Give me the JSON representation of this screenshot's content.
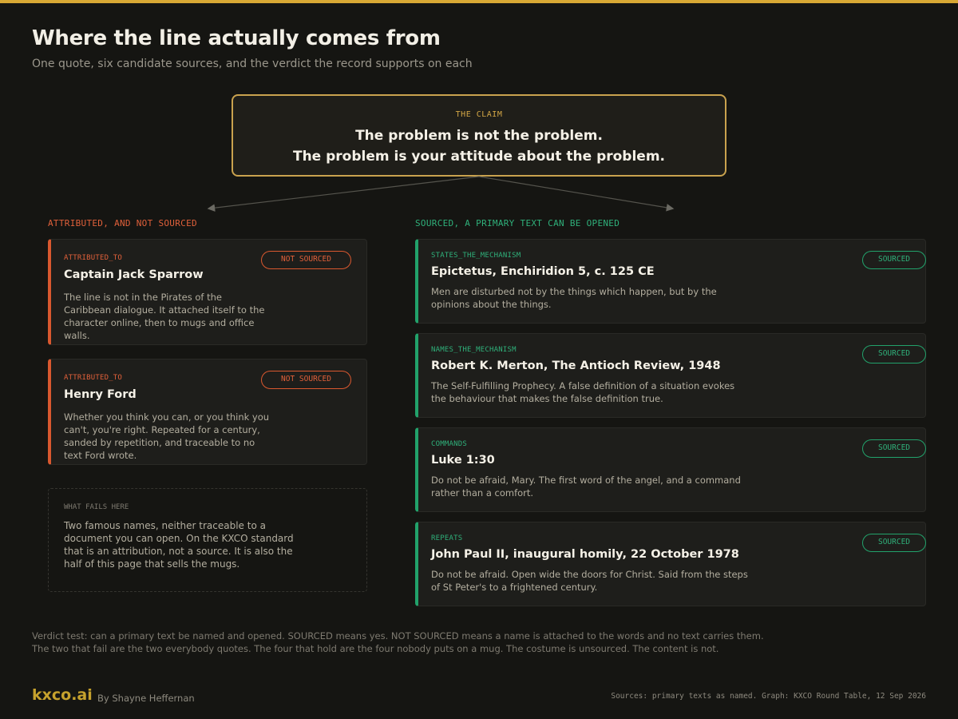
{
  "header": {
    "title": "Where the line actually comes from",
    "subtitle": "One quote, six candidate sources, and the verdict the record supports on each"
  },
  "claim": {
    "label": "THE CLAIM",
    "line1": "The problem is not the problem.",
    "line2": "The problem is your attitude about the problem."
  },
  "sections": {
    "left": "ATTRIBUTED, AND NOT SOURCED",
    "right": "SOURCED, A PRIMARY TEXT CAN BE OPENED"
  },
  "left_cards": [
    {
      "tag": "ATTRIBUTED_TO",
      "name": "Captain Jack Sparrow",
      "badge": "NOT SOURCED",
      "body": "The line is not in the Pirates of the Caribbean dialogue. It attached itself to the character online, then to mugs and office walls."
    },
    {
      "tag": "ATTRIBUTED_TO",
      "name": "Henry Ford",
      "badge": "NOT SOURCED",
      "body": "Whether you think you can, or you think you can't, you're right. Repeated for a century, sanded by repetition, and traceable to no text Ford wrote."
    }
  ],
  "fails": {
    "label": "WHAT FAILS HERE",
    "body": "Two famous names, neither traceable to a document you can open. On the KXCO standard that is an attribution, not a source. It is also the half of this page that sells the mugs."
  },
  "right_cards": [
    {
      "tag": "STATES_THE_MECHANISM",
      "name": "Epictetus, Enchiridion 5, c. 125 CE",
      "badge": "SOURCED",
      "body": "Men are disturbed not by the things which happen, but by the opinions about the things."
    },
    {
      "tag": "NAMES_THE_MECHANISM",
      "name": "Robert K. Merton, The Antioch Review, 1948",
      "badge": "SOURCED",
      "body": "The Self-Fulfilling Prophecy. A false definition of a situation evokes the behaviour that makes the false definition true."
    },
    {
      "tag": "COMMANDS",
      "name": "Luke 1:30",
      "badge": "SOURCED",
      "body": "Do not be afraid, Mary. The first word of the angel, and a command rather than a comfort."
    },
    {
      "tag": "REPEATS",
      "name": "John Paul II, inaugural homily, 22 October 1978",
      "badge": "SOURCED",
      "body": "Do not be afraid. Open wide the doors for Christ. Said from the steps of St Peter's to a frightened century."
    }
  ],
  "verdict": {
    "line1": "Verdict test: can a primary text be named and opened. SOURCED means yes. NOT SOURCED means a name is attached to the words and no text carries them.",
    "line2": "The two that fail are the two everybody quotes. The four that hold are the four nobody puts on a mug. The costume is unsourced. The content is not."
  },
  "footer": {
    "brand": "kxco.ai",
    "byline": "By Shayne Heffernan",
    "sources": "Sources: primary texts as named. Graph: KXCO Round Table, 12 Sep 2026"
  },
  "colors": {
    "accent": "#d8a834",
    "not_sourced": "#d9582f",
    "sourced": "#22a26b",
    "background": "#151512"
  }
}
